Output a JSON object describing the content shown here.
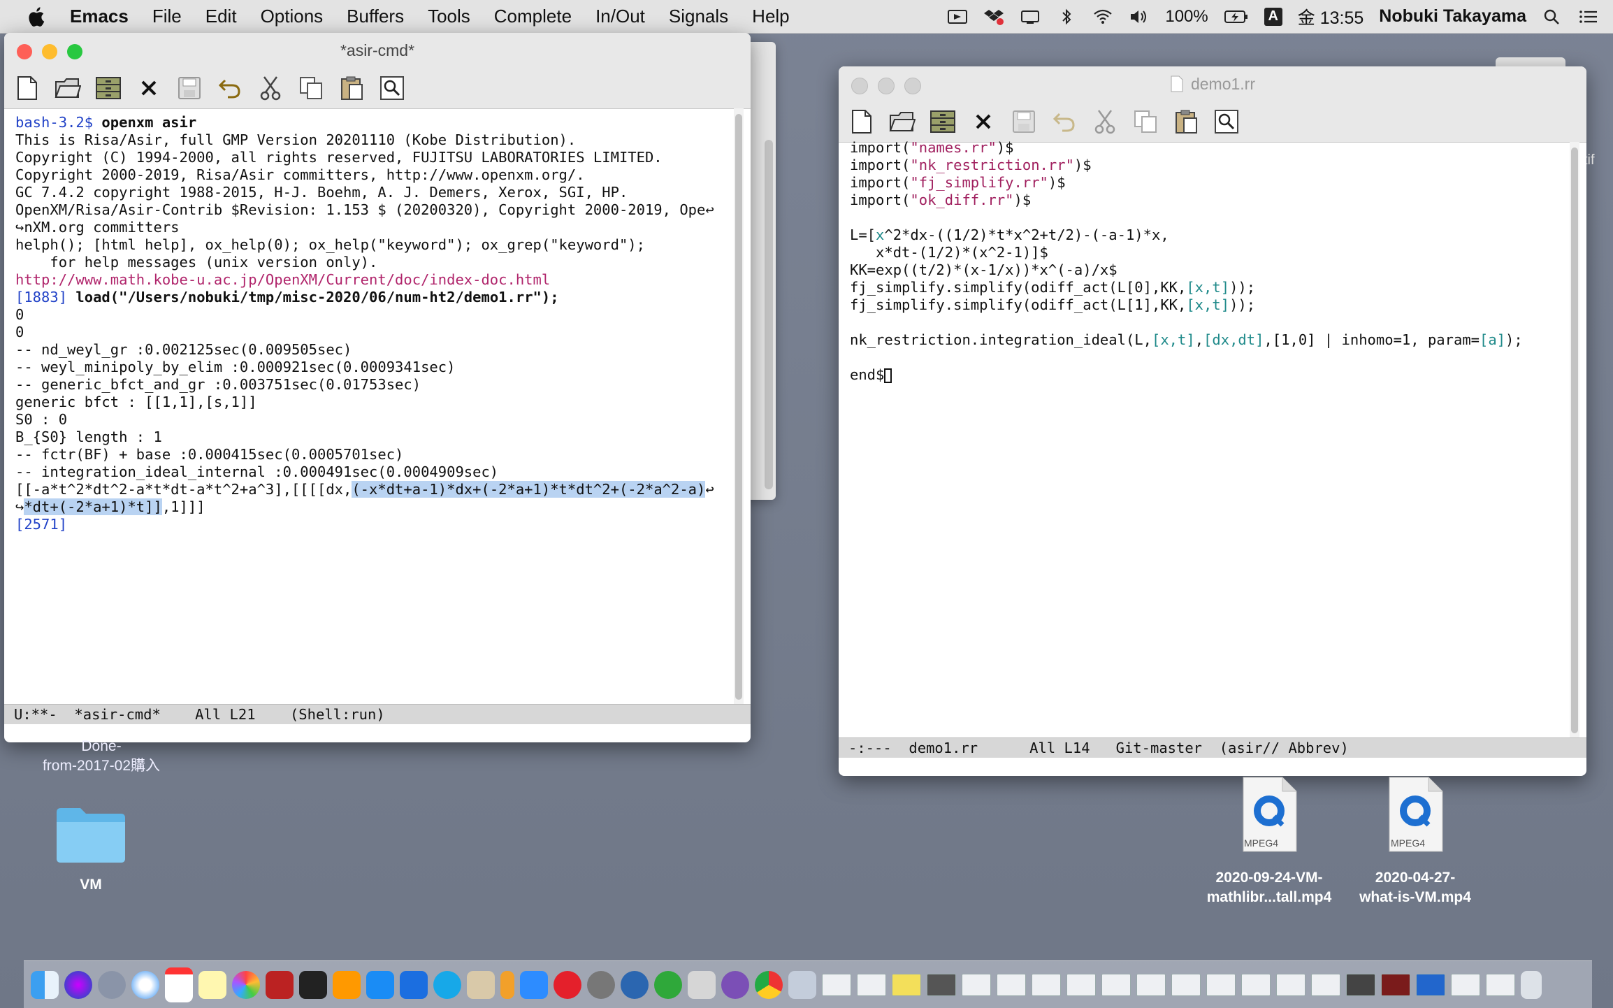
{
  "menubar": {
    "app": "Emacs",
    "items": [
      "File",
      "Edit",
      "Options",
      "Buffers",
      "Tools",
      "Complete",
      "In/Out",
      "Signals",
      "Help"
    ],
    "battery": "100%",
    "clock": "金 13:55",
    "user": "Nobuki Takayama",
    "input_mode": "A"
  },
  "left_window": {
    "title": "*asir-cmd*",
    "lines": [
      [
        {
          "t": "bash-3.2$ ",
          "c": "prompt"
        },
        {
          "t": "openxm asir",
          "c": "bold"
        }
      ],
      [
        {
          "t": "This is Risa/Asir, full GMP Version 20201110 (Kobe Distribution)."
        }
      ],
      [
        {
          "t": "Copyright (C) 1994-2000, all rights reserved, FUJITSU LABORATORIES LIMITED."
        }
      ],
      [
        {
          "t": "Copyright 2000-2019, Risa/Asir committers, http://www.openxm.org/."
        }
      ],
      [
        {
          "t": "GC 7.4.2 copyright 1988-2015, H-J. Boehm, A. J. Demers, Xerox, SGI, HP."
        }
      ],
      [
        {
          "t": "OpenXM/Risa/Asir-Contrib $Revision: 1.153 $ (20200320), Copyright 2000-2019, Ope"
        },
        {
          "t": "↩",
          "c": "wrapmark"
        }
      ],
      [
        {
          "t": "↪",
          "c": "wrapmark"
        },
        {
          "t": "nXM.org committers"
        }
      ],
      [
        {
          "t": "helph(); [html help], ox_help(0); ox_help(\"keyword\"); ox_grep(\"keyword\");"
        }
      ],
      [
        {
          "t": "    for help messages (unix version only)."
        }
      ],
      [
        {
          "t": "http://www.math.kobe-u.ac.jp/OpenXM/Current/doc/index-doc.html",
          "c": "link"
        }
      ],
      [
        {
          "t": "[1883] ",
          "c": "prompt"
        },
        {
          "t": "load(\"/Users/nobuki/tmp/misc-2020/06/num-ht2/demo1.rr\");",
          "c": "bold"
        }
      ],
      [
        {
          "t": "0"
        }
      ],
      [
        {
          "t": "0"
        }
      ],
      [
        {
          "t": "-- nd_weyl_gr :0.002125sec(0.009505sec)"
        }
      ],
      [
        {
          "t": "-- weyl_minipoly_by_elim :0.000921sec(0.0009341sec)"
        }
      ],
      [
        {
          "t": "-- generic_bfct_and_gr :0.003751sec(0.01753sec)"
        }
      ],
      [
        {
          "t": "generic bfct : [[1,1],[s,1]]"
        }
      ],
      [
        {
          "t": "S0 : 0"
        }
      ],
      [
        {
          "t": "B_{S0} length : 1"
        }
      ],
      [
        {
          "t": "-- fctr(BF) + base :0.000415sec(0.0005701sec)"
        }
      ],
      [
        {
          "t": "-- integration_ideal_internal :0.000491sec(0.0004909sec)"
        }
      ],
      [
        {
          "t": "[[-a*t^2*dt^2-a*t*dt-a*t^2+a^3],[[[[dx,"
        },
        {
          "t": "(-x*dt+a-1)*dx+(-2*a+1)*t*dt^2+(-2*a^2-a)",
          "c": "hl"
        },
        {
          "t": "↩",
          "c": "wrapmark"
        }
      ],
      [
        {
          "t": "↪",
          "c": "wrapmark"
        },
        {
          "t": "*dt+(-2*a+1)*t]]",
          "c": "hl"
        },
        {
          "t": ",1]]]"
        }
      ],
      [
        {
          "t": "[2571]",
          "c": "prompt"
        }
      ]
    ],
    "modeline": "U:**-  *asir-cmd*    All L21    (Shell:run)"
  },
  "right_window": {
    "title": "demo1.rr",
    "lines": [
      [
        {
          "t": "import("
        },
        {
          "t": "\"names.rr\"",
          "c": "str"
        },
        {
          "t": ")$"
        }
      ],
      [
        {
          "t": "import("
        },
        {
          "t": "\"nk_restriction.rr\"",
          "c": "str"
        },
        {
          "t": ")$"
        }
      ],
      [
        {
          "t": "import("
        },
        {
          "t": "\"fj_simplify.rr\"",
          "c": "str"
        },
        {
          "t": ")$"
        }
      ],
      [
        {
          "t": "import("
        },
        {
          "t": "\"ok_diff.rr\"",
          "c": "str"
        },
        {
          "t": ")$"
        }
      ],
      [
        {
          "t": ""
        }
      ],
      [
        {
          "t": "L=["
        },
        {
          "t": "x",
          "c": "var"
        },
        {
          "t": "^2*dx-((1/2)*t*x^2+t/2)-(-a-1)*x,"
        }
      ],
      [
        {
          "t": "   x*dt-(1/2)*(x^2-1)]$"
        }
      ],
      [
        {
          "t": "KK=exp((t/2)*(x-1/x))*x^(-a)/x$"
        }
      ],
      [
        {
          "t": "fj_simplify.simplify(odiff_act(L[0],KK,"
        },
        {
          "t": "[x,t]",
          "c": "var"
        },
        {
          "t": "));"
        }
      ],
      [
        {
          "t": "fj_simplify.simplify(odiff_act(L[1],KK,"
        },
        {
          "t": "[x,t]",
          "c": "var"
        },
        {
          "t": "));"
        }
      ],
      [
        {
          "t": ""
        }
      ],
      [
        {
          "t": "nk_restriction.integration_ideal(L,"
        },
        {
          "t": "[x,t]",
          "c": "var"
        },
        {
          "t": ","
        },
        {
          "t": "[dx,dt]",
          "c": "var"
        },
        {
          "t": ",[1,0] | inhomo=1, param="
        },
        {
          "t": "[a]",
          "c": "var"
        },
        {
          "t": ");"
        }
      ],
      [
        {
          "t": ""
        }
      ],
      [
        {
          "t": "end$"
        },
        {
          "t": " ",
          "c": "cursor"
        }
      ]
    ],
    "modeline": "-:---  demo1.rr      All L14   Git-master  (asir// Abbrev)"
  },
  "desktop": {
    "folder_done_label": "Done-\nfrom-2017-02購入",
    "folder_vm_label": "VM",
    "file1_label": "2020-09-24-VM-\nmathlibr...tall.mp4",
    "file2_label": "2020-04-27-\nwhat-is-VM.mp4",
    "mpeg_badge": "MPEG4",
    "peek_text": "tif"
  },
  "colors": {
    "prompt": "#2142c7",
    "string": "#a01f5e",
    "variable": "#1f8a8a",
    "highlight": "#b9d3f2",
    "close": "#fe5f57",
    "minimize": "#febc2e",
    "zoom": "#28c840"
  }
}
